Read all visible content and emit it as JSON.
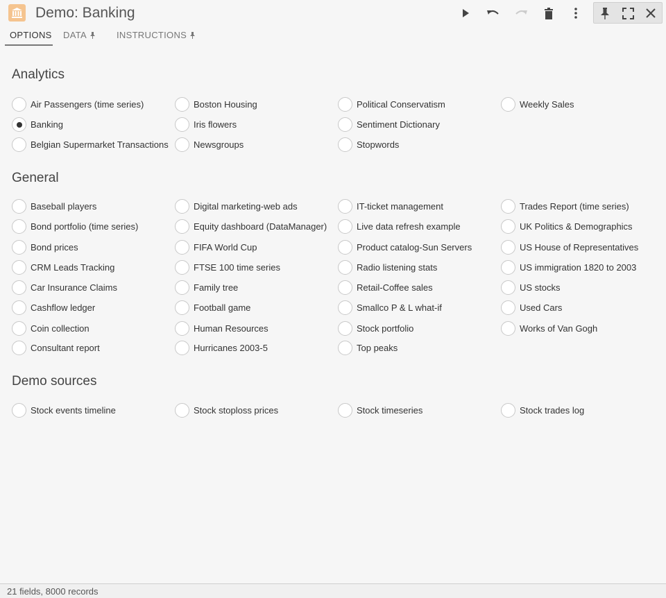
{
  "window": {
    "title": "Demo: Banking",
    "app_icon": "bank-icon",
    "accent_color": "#f5c48f"
  },
  "toolbar": {
    "run_icon": "play-icon",
    "undo_icon": "undo-icon",
    "redo_icon": "redo-icon",
    "delete_icon": "trash-icon",
    "more_icon": "more-vertical-icon",
    "pin_icon": "pin-icon",
    "maximize_icon": "maximize-icon",
    "close_icon": "close-icon"
  },
  "tabs": [
    {
      "label": "OPTIONS",
      "active": true
    },
    {
      "label": "DATA",
      "pinned": true
    },
    {
      "label": "INSTRUCTIONS",
      "pinned": true
    }
  ],
  "sections": [
    {
      "title": "Analytics",
      "options": [
        [
          "Air Passengers (time series)",
          "Boston Housing",
          "Political Conservatism",
          "Weekly Sales"
        ],
        [
          "Banking",
          "Iris flowers",
          "Sentiment Dictionary",
          ""
        ],
        [
          "Belgian Supermarket Transactions",
          "Newsgroups",
          "Stopwords",
          ""
        ]
      ]
    },
    {
      "title": "General",
      "options": [
        [
          "Baseball players",
          "Digital marketing-web ads",
          "IT-ticket management",
          "Trades Report (time series)"
        ],
        [
          "Bond portfolio (time series)",
          "Equity dashboard (DataManager)",
          "Live data refresh example",
          "UK Politics & Demographics"
        ],
        [
          "Bond prices",
          "FIFA World Cup",
          "Product catalog-Sun Servers",
          "US House of Representatives"
        ],
        [
          "CRM Leads Tracking",
          "FTSE 100 time series",
          "Radio listening stats",
          "US immigration 1820 to 2003"
        ],
        [
          "Car Insurance Claims",
          "Family tree",
          "Retail-Coffee sales",
          "US stocks"
        ],
        [
          "Cashflow ledger",
          "Football game",
          "Smallco P & L what-if",
          "Used Cars"
        ],
        [
          "Coin collection",
          "Human Resources",
          "Stock portfolio",
          "Works of Van Gogh"
        ],
        [
          "Consultant report",
          "Hurricanes 2003-5",
          "Top peaks",
          ""
        ]
      ]
    },
    {
      "title": "Demo sources",
      "options": [
        [
          "Stock events timeline",
          "Stock stoploss prices",
          "Stock timeseries",
          "Stock trades log"
        ]
      ]
    }
  ],
  "selected": "Banking",
  "status": {
    "text": "21 fields, 8000 records"
  }
}
